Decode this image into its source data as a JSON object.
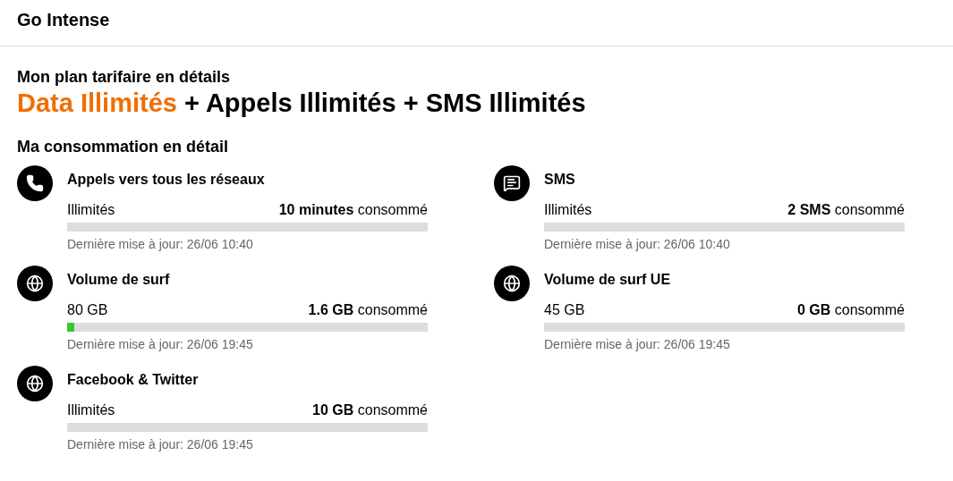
{
  "header": {
    "title": "Go Intense"
  },
  "plan": {
    "heading": "Mon plan tarifaire en détails",
    "parts": [
      {
        "kind": "highlight",
        "text": "Data Illimités"
      },
      {
        "kind": "plain",
        "text": " + Appels Illimités + SMS Illimités"
      }
    ]
  },
  "consumption": {
    "heading": "Ma consommation en détail",
    "items": [
      {
        "kind": "phone",
        "title": "Appels vers tous les réseaux",
        "allowance": "Illimités",
        "used": "10 minutes",
        "used_suffix": "consommé",
        "updated": "Dernière mise à jour: 26/06 10:40"
      },
      {
        "kind": "sms",
        "title": "SMS",
        "allowance": "Illimités",
        "used": "2 SMS",
        "used_suffix": "consommé",
        "updated": "Dernière mise à jour: 26/06 10:40"
      },
      {
        "kind": "globe",
        "title": "Volume de surf",
        "allowance": "80 GB",
        "used": "1.6 GB",
        "used_suffix": "consommé",
        "level": 0.02,
        "updated": "Dernière mise à jour: 26/06 19:45"
      },
      {
        "kind": "globe",
        "title": "Volume de surf UE",
        "allowance": "45 GB",
        "used": "0 GB",
        "used_suffix": "consommé",
        "updated": "Dernière mise à jour: 26/06 19:45"
      },
      {
        "kind": "globe",
        "title": "Facebook & Twitter",
        "allowance": "Illimités",
        "used": "10 GB",
        "used_suffix": "consommé",
        "updated": "Dernière mise à jour: 26/06 19:45"
      }
    ]
  }
}
